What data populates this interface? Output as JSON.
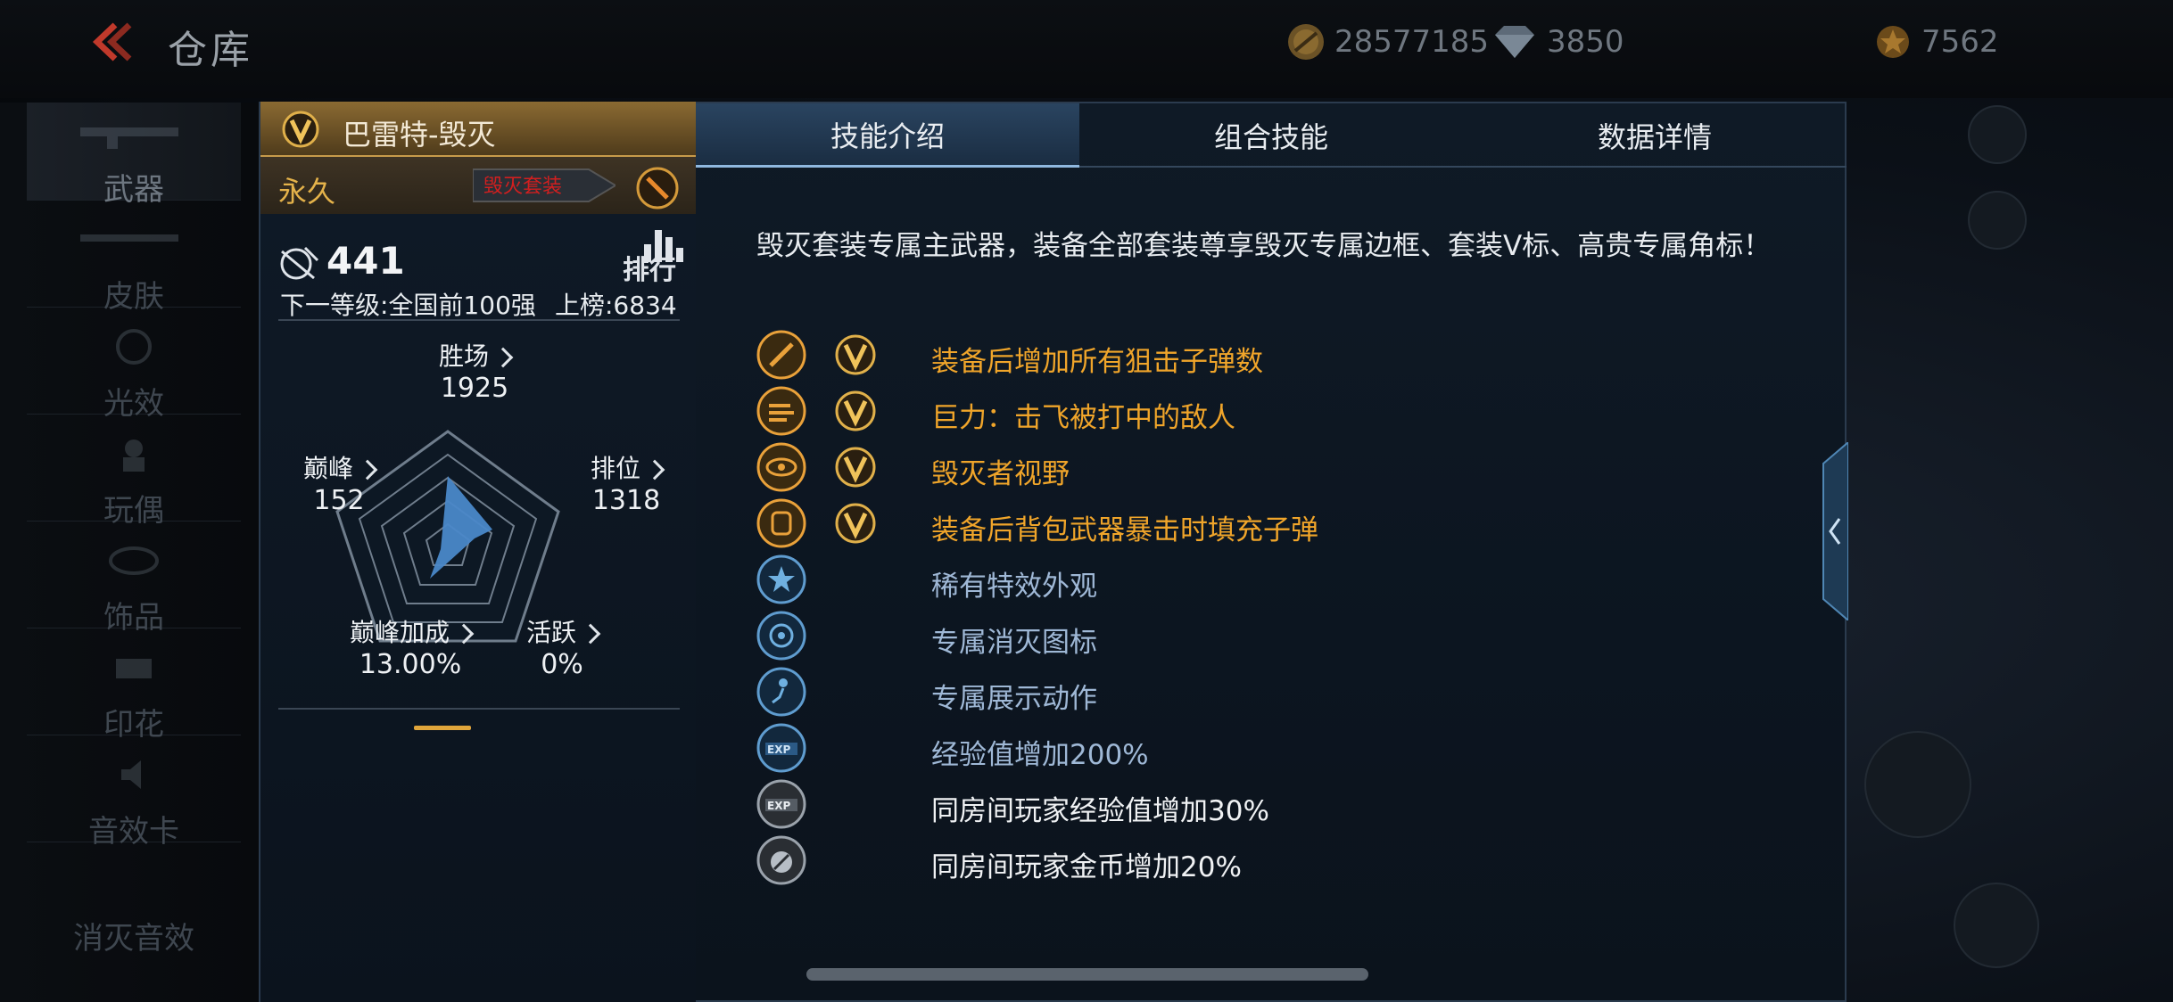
{
  "header": {
    "title": "仓库",
    "back_icon": "back-chevron-icon",
    "currencies": [
      {
        "name": "coin",
        "value": "28577185",
        "icon": "coin-icon",
        "color": "#c79a3a"
      },
      {
        "name": "diamond",
        "value": "3850",
        "icon": "diamond-icon",
        "color": "#9fb3c8"
      },
      {
        "name": "voucher",
        "value": "7562",
        "icon": "voucher-icon",
        "color": "#c98b2d"
      }
    ]
  },
  "sidebar": {
    "items": [
      {
        "label": "武器",
        "icon": "rifle-icon"
      },
      {
        "label": "皮肤",
        "icon": "rifle-skin-icon"
      },
      {
        "label": "光效",
        "icon": "light-effect-icon"
      },
      {
        "label": "玩偶",
        "icon": "doll-icon"
      },
      {
        "label": "饰品",
        "icon": "ornament-icon"
      },
      {
        "label": "印花",
        "icon": "spray-icon"
      },
      {
        "label": "音效卡",
        "icon": "sound-card-icon"
      },
      {
        "label": "消灭音效",
        "icon": "kill-sound-icon"
      }
    ]
  },
  "weapon": {
    "name": "巴雷特-毁灭",
    "duration": "永久",
    "tag_text": "毁灭套装",
    "kills": "441",
    "rank_label": "排行",
    "next_level": "下一等级:全国前100强",
    "leaderboard": "上榜:6834"
  },
  "stats": {
    "wins": {
      "label": "胜场",
      "value": "1925"
    },
    "ranked": {
      "label": "排位",
      "value": "1318"
    },
    "active": {
      "label": "活跃",
      "value": "0%"
    },
    "peak_bonus": {
      "label": "巅峰加成",
      "value": "13.00%"
    },
    "peak": {
      "label": "巅峰",
      "value": "152"
    }
  },
  "tabs": [
    {
      "label": "技能介绍",
      "active": true
    },
    {
      "label": "组合技能",
      "active": false
    },
    {
      "label": "数据详情",
      "active": false
    }
  ],
  "description": "毁灭套装专属主武器，装备全部套装尊享毁灭专属边框、套装V标、高贵专属角标！",
  "skills": [
    {
      "text": "装备后增加所有狙击子弹数",
      "icon": "sniper-ammo-icon",
      "suit_badge": true,
      "tier": "orange"
    },
    {
      "text": "巨力：击飞被打中的敌人",
      "icon": "knockback-icon",
      "suit_badge": true,
      "tier": "orange"
    },
    {
      "text": "毁灭者视野",
      "icon": "eye-icon",
      "suit_badge": true,
      "tier": "orange"
    },
    {
      "text": "装备后背包武器暴击时填充子弹",
      "icon": "backpack-reload-icon",
      "suit_badge": true,
      "tier": "orange"
    },
    {
      "text": "稀有特效外观",
      "icon": "star-icon",
      "suit_badge": false,
      "tier": "blue"
    },
    {
      "text": "专属消灭图标",
      "icon": "kill-emblem-icon",
      "suit_badge": false,
      "tier": "blue"
    },
    {
      "text": "专属展示动作",
      "icon": "showcase-pose-icon",
      "suit_badge": false,
      "tier": "blue"
    },
    {
      "text": "经验值增加200%",
      "icon": "exp-icon",
      "suit_badge": false,
      "tier": "blue"
    },
    {
      "text": "同房间玩家经验值增加30%",
      "icon": "room-exp-icon",
      "suit_badge": false,
      "tier": "white"
    },
    {
      "text": "同房间玩家金币增加20%",
      "icon": "room-coin-icon",
      "suit_badge": false,
      "tier": "white"
    }
  ],
  "colors": {
    "accent_orange": "#f0a52a",
    "accent_blue": "#9fb8d6",
    "panel_bg": "#0f1a26",
    "gold_header": "#8a6a32"
  }
}
